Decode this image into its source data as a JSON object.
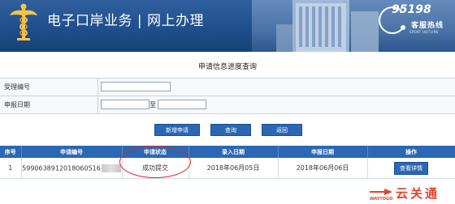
{
  "header": {
    "title": "电子口岸业务 | 网上办理",
    "hotline_number": "95198",
    "hotline_label": "客服热线",
    "hotline_en": "EPORT HOTLINE"
  },
  "page": {
    "title": "申请信息进度查询"
  },
  "form": {
    "acceptance_no_label": "受理编号",
    "acceptance_no_value": "",
    "apply_date_label": "申报日期",
    "date_from_value": "",
    "date_to_label": "至",
    "date_to_value": ""
  },
  "buttons": {
    "new_application": "新增申请",
    "query": "查询",
    "back": "返回"
  },
  "table": {
    "headers": [
      "序号",
      "申请编号",
      "申请状态",
      "录入日期",
      "申报日期",
      "操作"
    ],
    "rows": [
      {
        "index": "1",
        "application_no": "5990638912018060516",
        "status": "成功提交",
        "entry_date": "2018年06月05日",
        "apply_date": "2018年06月06日",
        "action": "查看详情"
      }
    ]
  },
  "watermark": {
    "cn": "云关通",
    "en": "WAYTOGO"
  },
  "colors": {
    "banner": "#1f4f8c",
    "button": "#2c67b4",
    "table_header": "#2c67b4",
    "annotation_circle": "#d8261e",
    "watermark": "#e5402a"
  }
}
